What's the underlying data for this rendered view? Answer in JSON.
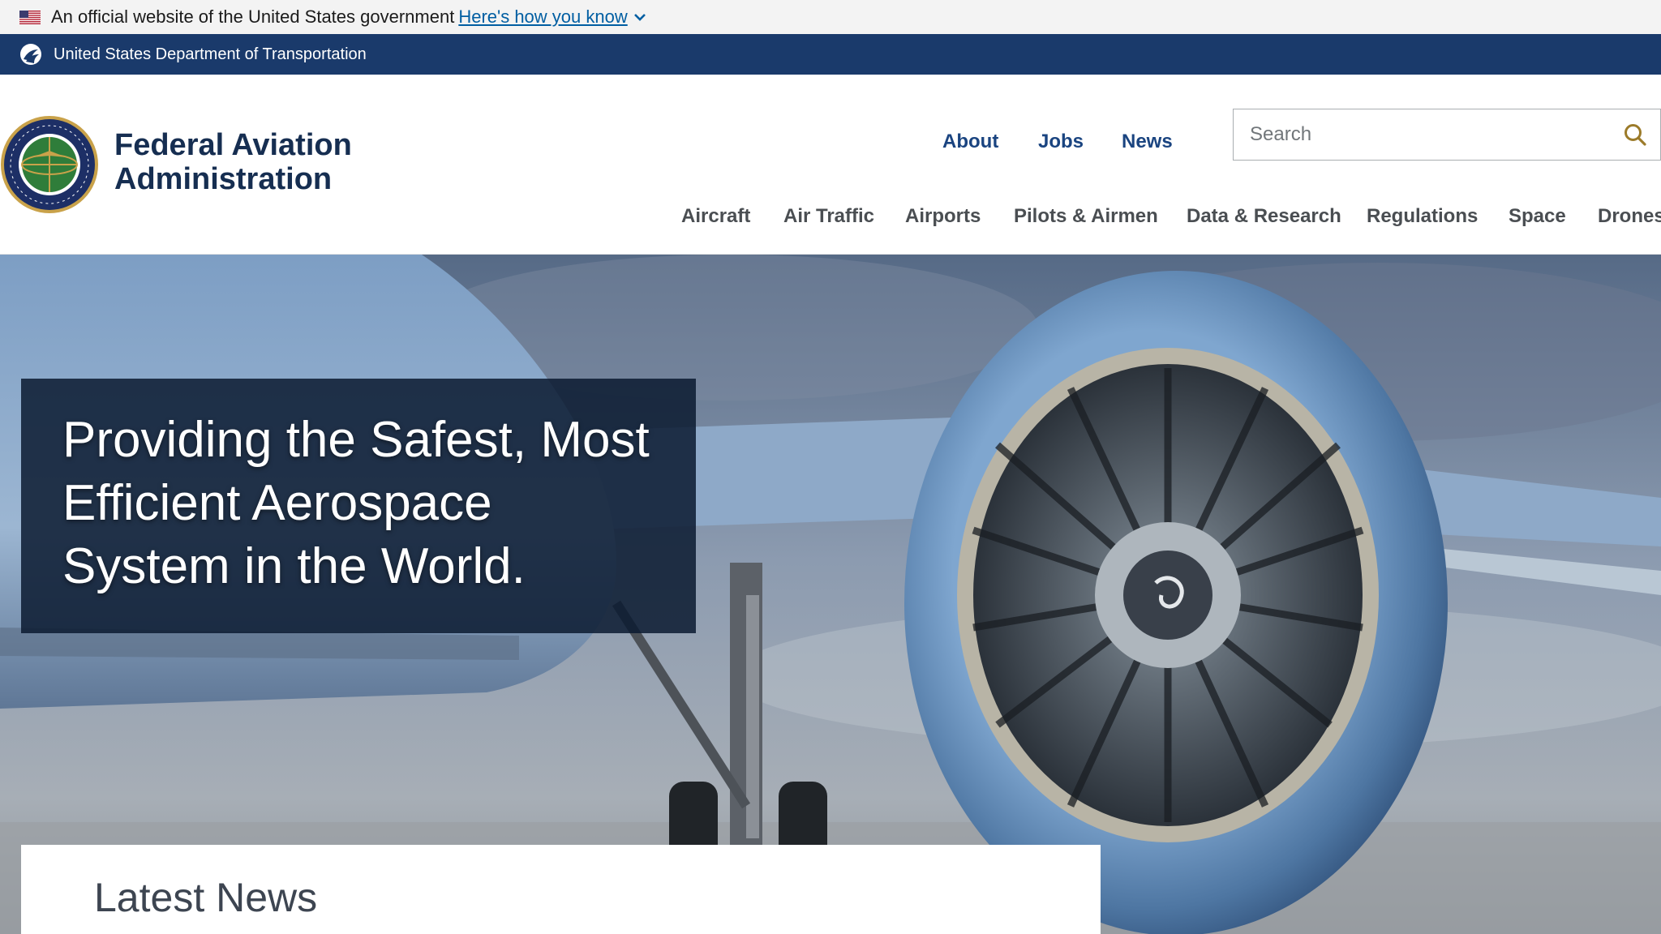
{
  "gov_banner": {
    "text": "An official website of the United States government",
    "link": "Here's how you know"
  },
  "dot_bar": {
    "text": "United States Department of Transportation"
  },
  "header": {
    "agency_line1": "Federal Aviation",
    "agency_line2": "Administration",
    "utility_nav": [
      {
        "label": "About"
      },
      {
        "label": "Jobs"
      },
      {
        "label": "News"
      }
    ],
    "search": {
      "placeholder": "Search"
    },
    "main_nav": [
      {
        "label": "Aircraft"
      },
      {
        "label": "Air Traffic"
      },
      {
        "label": "Airports"
      },
      {
        "label": "Pilots & Airmen"
      },
      {
        "label": "Data & Research"
      },
      {
        "label": "Regulations"
      },
      {
        "label": "Space"
      },
      {
        "label": "Drones"
      }
    ]
  },
  "hero": {
    "title_line1": "Providing the Safest, Most",
    "title_line2": "Efficient Aerospace",
    "title_line3": "System in the World."
  },
  "news": {
    "title": "Latest News"
  },
  "colors": {
    "navy": "#1a3a6b",
    "agency_text": "#162e51",
    "link_blue": "#005ea2",
    "search_icon": "#9c7b2a"
  }
}
